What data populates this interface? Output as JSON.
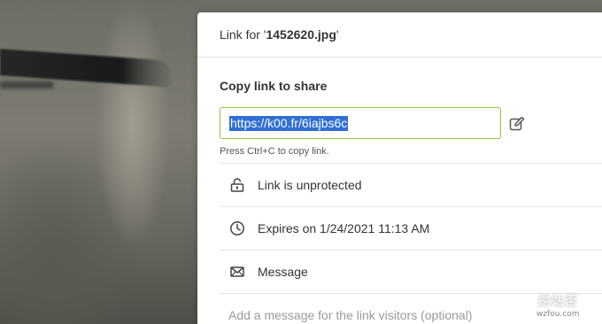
{
  "dialog": {
    "title_prefix": "Link for '",
    "file_name": "1452620.jpg",
    "title_suffix": "'"
  },
  "share": {
    "section_title": "Copy link to share",
    "link_url": "https://k00.fr/6iajbs6c",
    "hint": "Press Ctrl+C to copy link."
  },
  "options": {
    "protection": "Link is unprotected",
    "expiry": "Expires on 1/24/2021 11:13 AM",
    "message_label": "Message",
    "message_placeholder": "Add a message for the link visitors (optional)"
  },
  "watermark": {
    "title": "挖站否",
    "sub": "wzfou.com"
  },
  "icons": {
    "edit": "edit-icon",
    "lock": "unlocked-lock-icon",
    "clock": "clock-icon",
    "mail": "envelope-icon"
  },
  "colors": {
    "input_border": "#8cc63f",
    "selection": "#2f6fd6"
  }
}
